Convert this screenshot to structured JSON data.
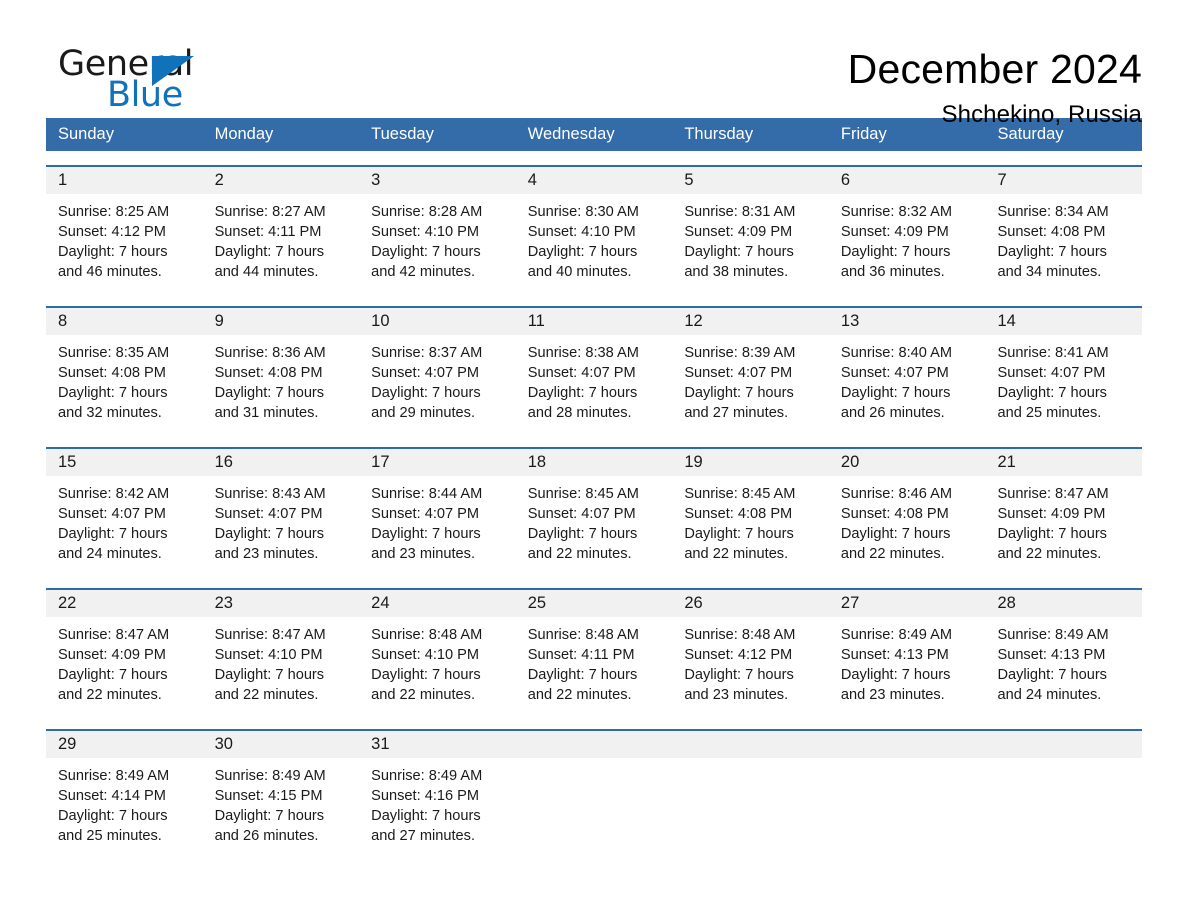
{
  "brand": {
    "name_part1": "General",
    "name_part2": "Blue",
    "accent_color": "#1072bb"
  },
  "header": {
    "title": "December 2024",
    "location": "Shchekino, Russia"
  },
  "theme": {
    "header_row_color": "#336ca8",
    "row_divider_color": "#2e6ca4",
    "daynum_band_color": "#f1f1f1",
    "text_color": "#1a1a1a"
  },
  "weekday_headers": [
    "Sunday",
    "Monday",
    "Tuesday",
    "Wednesday",
    "Thursday",
    "Friday",
    "Saturday"
  ],
  "weeks": [
    [
      {
        "day": "1",
        "sunrise": "Sunrise: 8:25 AM",
        "sunset": "Sunset: 4:12 PM",
        "daylight_line1": "Daylight: 7 hours",
        "daylight_line2": "and 46 minutes."
      },
      {
        "day": "2",
        "sunrise": "Sunrise: 8:27 AM",
        "sunset": "Sunset: 4:11 PM",
        "daylight_line1": "Daylight: 7 hours",
        "daylight_line2": "and 44 minutes."
      },
      {
        "day": "3",
        "sunrise": "Sunrise: 8:28 AM",
        "sunset": "Sunset: 4:10 PM",
        "daylight_line1": "Daylight: 7 hours",
        "daylight_line2": "and 42 minutes."
      },
      {
        "day": "4",
        "sunrise": "Sunrise: 8:30 AM",
        "sunset": "Sunset: 4:10 PM",
        "daylight_line1": "Daylight: 7 hours",
        "daylight_line2": "and 40 minutes."
      },
      {
        "day": "5",
        "sunrise": "Sunrise: 8:31 AM",
        "sunset": "Sunset: 4:09 PM",
        "daylight_line1": "Daylight: 7 hours",
        "daylight_line2": "and 38 minutes."
      },
      {
        "day": "6",
        "sunrise": "Sunrise: 8:32 AM",
        "sunset": "Sunset: 4:09 PM",
        "daylight_line1": "Daylight: 7 hours",
        "daylight_line2": "and 36 minutes."
      },
      {
        "day": "7",
        "sunrise": "Sunrise: 8:34 AM",
        "sunset": "Sunset: 4:08 PM",
        "daylight_line1": "Daylight: 7 hours",
        "daylight_line2": "and 34 minutes."
      }
    ],
    [
      {
        "day": "8",
        "sunrise": "Sunrise: 8:35 AM",
        "sunset": "Sunset: 4:08 PM",
        "daylight_line1": "Daylight: 7 hours",
        "daylight_line2": "and 32 minutes."
      },
      {
        "day": "9",
        "sunrise": "Sunrise: 8:36 AM",
        "sunset": "Sunset: 4:08 PM",
        "daylight_line1": "Daylight: 7 hours",
        "daylight_line2": "and 31 minutes."
      },
      {
        "day": "10",
        "sunrise": "Sunrise: 8:37 AM",
        "sunset": "Sunset: 4:07 PM",
        "daylight_line1": "Daylight: 7 hours",
        "daylight_line2": "and 29 minutes."
      },
      {
        "day": "11",
        "sunrise": "Sunrise: 8:38 AM",
        "sunset": "Sunset: 4:07 PM",
        "daylight_line1": "Daylight: 7 hours",
        "daylight_line2": "and 28 minutes."
      },
      {
        "day": "12",
        "sunrise": "Sunrise: 8:39 AM",
        "sunset": "Sunset: 4:07 PM",
        "daylight_line1": "Daylight: 7 hours",
        "daylight_line2": "and 27 minutes."
      },
      {
        "day": "13",
        "sunrise": "Sunrise: 8:40 AM",
        "sunset": "Sunset: 4:07 PM",
        "daylight_line1": "Daylight: 7 hours",
        "daylight_line2": "and 26 minutes."
      },
      {
        "day": "14",
        "sunrise": "Sunrise: 8:41 AM",
        "sunset": "Sunset: 4:07 PM",
        "daylight_line1": "Daylight: 7 hours",
        "daylight_line2": "and 25 minutes."
      }
    ],
    [
      {
        "day": "15",
        "sunrise": "Sunrise: 8:42 AM",
        "sunset": "Sunset: 4:07 PM",
        "daylight_line1": "Daylight: 7 hours",
        "daylight_line2": "and 24 minutes."
      },
      {
        "day": "16",
        "sunrise": "Sunrise: 8:43 AM",
        "sunset": "Sunset: 4:07 PM",
        "daylight_line1": "Daylight: 7 hours",
        "daylight_line2": "and 23 minutes."
      },
      {
        "day": "17",
        "sunrise": "Sunrise: 8:44 AM",
        "sunset": "Sunset: 4:07 PM",
        "daylight_line1": "Daylight: 7 hours",
        "daylight_line2": "and 23 minutes."
      },
      {
        "day": "18",
        "sunrise": "Sunrise: 8:45 AM",
        "sunset": "Sunset: 4:07 PM",
        "daylight_line1": "Daylight: 7 hours",
        "daylight_line2": "and 22 minutes."
      },
      {
        "day": "19",
        "sunrise": "Sunrise: 8:45 AM",
        "sunset": "Sunset: 4:08 PM",
        "daylight_line1": "Daylight: 7 hours",
        "daylight_line2": "and 22 minutes."
      },
      {
        "day": "20",
        "sunrise": "Sunrise: 8:46 AM",
        "sunset": "Sunset: 4:08 PM",
        "daylight_line1": "Daylight: 7 hours",
        "daylight_line2": "and 22 minutes."
      },
      {
        "day": "21",
        "sunrise": "Sunrise: 8:47 AM",
        "sunset": "Sunset: 4:09 PM",
        "daylight_line1": "Daylight: 7 hours",
        "daylight_line2": "and 22 minutes."
      }
    ],
    [
      {
        "day": "22",
        "sunrise": "Sunrise: 8:47 AM",
        "sunset": "Sunset: 4:09 PM",
        "daylight_line1": "Daylight: 7 hours",
        "daylight_line2": "and 22 minutes."
      },
      {
        "day": "23",
        "sunrise": "Sunrise: 8:47 AM",
        "sunset": "Sunset: 4:10 PM",
        "daylight_line1": "Daylight: 7 hours",
        "daylight_line2": "and 22 minutes."
      },
      {
        "day": "24",
        "sunrise": "Sunrise: 8:48 AM",
        "sunset": "Sunset: 4:10 PM",
        "daylight_line1": "Daylight: 7 hours",
        "daylight_line2": "and 22 minutes."
      },
      {
        "day": "25",
        "sunrise": "Sunrise: 8:48 AM",
        "sunset": "Sunset: 4:11 PM",
        "daylight_line1": "Daylight: 7 hours",
        "daylight_line2": "and 22 minutes."
      },
      {
        "day": "26",
        "sunrise": "Sunrise: 8:48 AM",
        "sunset": "Sunset: 4:12 PM",
        "daylight_line1": "Daylight: 7 hours",
        "daylight_line2": "and 23 minutes."
      },
      {
        "day": "27",
        "sunrise": "Sunrise: 8:49 AM",
        "sunset": "Sunset: 4:13 PM",
        "daylight_line1": "Daylight: 7 hours",
        "daylight_line2": "and 23 minutes."
      },
      {
        "day": "28",
        "sunrise": "Sunrise: 8:49 AM",
        "sunset": "Sunset: 4:13 PM",
        "daylight_line1": "Daylight: 7 hours",
        "daylight_line2": "and 24 minutes."
      }
    ],
    [
      {
        "day": "29",
        "sunrise": "Sunrise: 8:49 AM",
        "sunset": "Sunset: 4:14 PM",
        "daylight_line1": "Daylight: 7 hours",
        "daylight_line2": "and 25 minutes."
      },
      {
        "day": "30",
        "sunrise": "Sunrise: 8:49 AM",
        "sunset": "Sunset: 4:15 PM",
        "daylight_line1": "Daylight: 7 hours",
        "daylight_line2": "and 26 minutes."
      },
      {
        "day": "31",
        "sunrise": "Sunrise: 8:49 AM",
        "sunset": "Sunset: 4:16 PM",
        "daylight_line1": "Daylight: 7 hours",
        "daylight_line2": "and 27 minutes."
      },
      {
        "day": "",
        "sunrise": "",
        "sunset": "",
        "daylight_line1": "",
        "daylight_line2": ""
      },
      {
        "day": "",
        "sunrise": "",
        "sunset": "",
        "daylight_line1": "",
        "daylight_line2": ""
      },
      {
        "day": "",
        "sunrise": "",
        "sunset": "",
        "daylight_line1": "",
        "daylight_line2": ""
      },
      {
        "day": "",
        "sunrise": "",
        "sunset": "",
        "daylight_line1": "",
        "daylight_line2": ""
      }
    ]
  ]
}
